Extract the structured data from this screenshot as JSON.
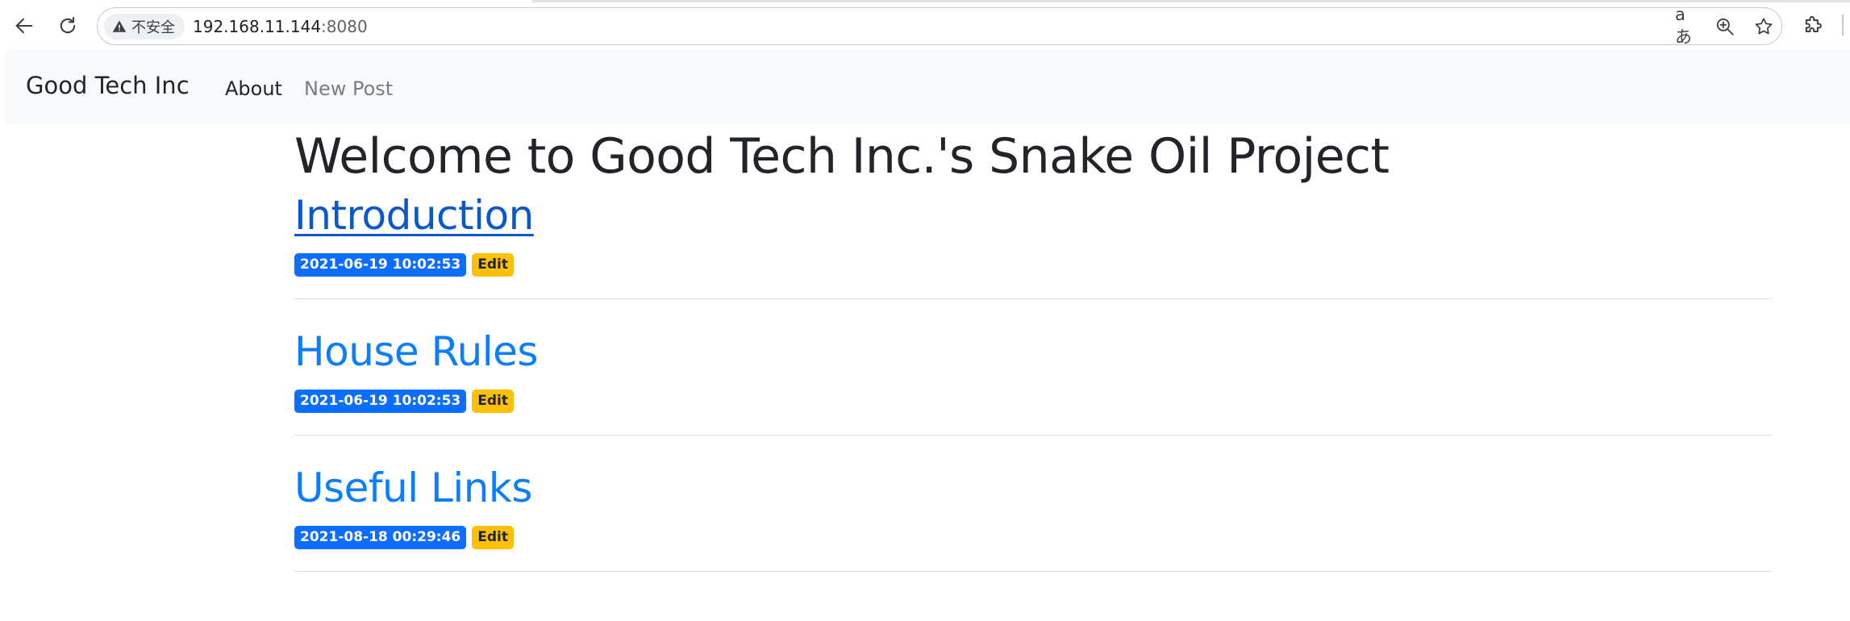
{
  "browser": {
    "security_label": "不安全",
    "url_host": "192.168.11.144",
    "url_port": ":8080",
    "translate_glyph": "aあ"
  },
  "navbar": {
    "brand": "Good Tech Inc",
    "items": [
      {
        "label": "About",
        "active": true
      },
      {
        "label": "New Post",
        "active": false
      }
    ]
  },
  "main": {
    "title": "Welcome to Good Tech Inc.'s Snake Oil Project",
    "posts": [
      {
        "title": "Introduction",
        "date": "2021-06-19 10:02:53",
        "edit_label": "Edit",
        "visited": true
      },
      {
        "title": "House Rules",
        "date": "2021-06-19 10:02:53",
        "edit_label": "Edit",
        "visited": false
      },
      {
        "title": "Useful Links",
        "date": "2021-08-18 00:29:46",
        "edit_label": "Edit",
        "visited": false
      }
    ]
  },
  "colors": {
    "link": "#0d7efb",
    "link_visited": "#0a58ca",
    "badge_primary": "#0d6efd",
    "badge_warning": "#ffc107",
    "navbar_bg": "#f8f9fa"
  }
}
